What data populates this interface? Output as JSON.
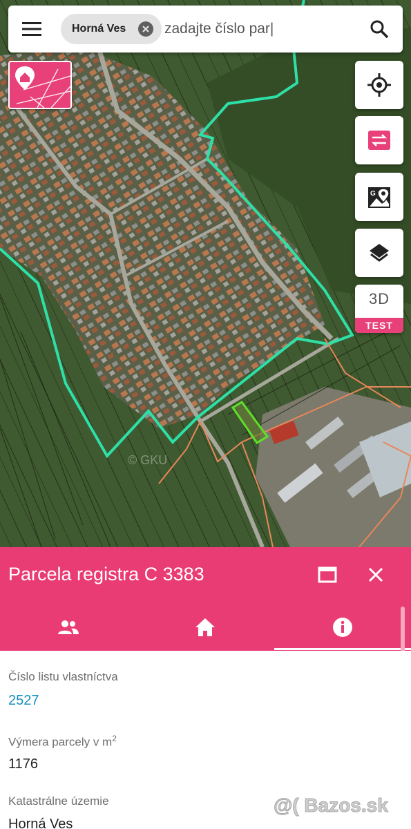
{
  "search": {
    "chip_label": "Horná Ves",
    "placeholder": "zadajte číslo par|"
  },
  "map": {
    "third_d": "3D",
    "test_badge": "TEST",
    "map_watermark": "© GKU"
  },
  "panel": {
    "title": "Parcela registra C 3383",
    "tabs": [
      "owners",
      "building",
      "info"
    ],
    "active_tab": 2
  },
  "fields": [
    {
      "label": "Číslo listu vlastníctva",
      "value": "2527",
      "link": true
    },
    {
      "label": "Výmera parcely v m",
      "label_sup": "2",
      "value": "1176",
      "link": false
    },
    {
      "label": "Katastrálne územie",
      "value": "Horná Ves",
      "link": false
    }
  ],
  "watermark": "@( Bazos.sk",
  "colors": {
    "accent": "#ea3c74",
    "link": "#1a8fbf",
    "boundary": "#2ee0a8",
    "selected_parcel": "#5ee02a",
    "orange_parcels": "#e8875a"
  },
  "icons": {
    "menu": "menu-icon",
    "clear": "close-circle-icon",
    "search": "search-icon",
    "locate": "crosshair-icon",
    "swap": "swap-icon",
    "map_pin": "map-pin-icon",
    "layers": "layers-icon",
    "maximize": "maximize-icon",
    "close": "close-icon",
    "people": "people-icon",
    "home": "home-icon",
    "info": "info-icon"
  }
}
